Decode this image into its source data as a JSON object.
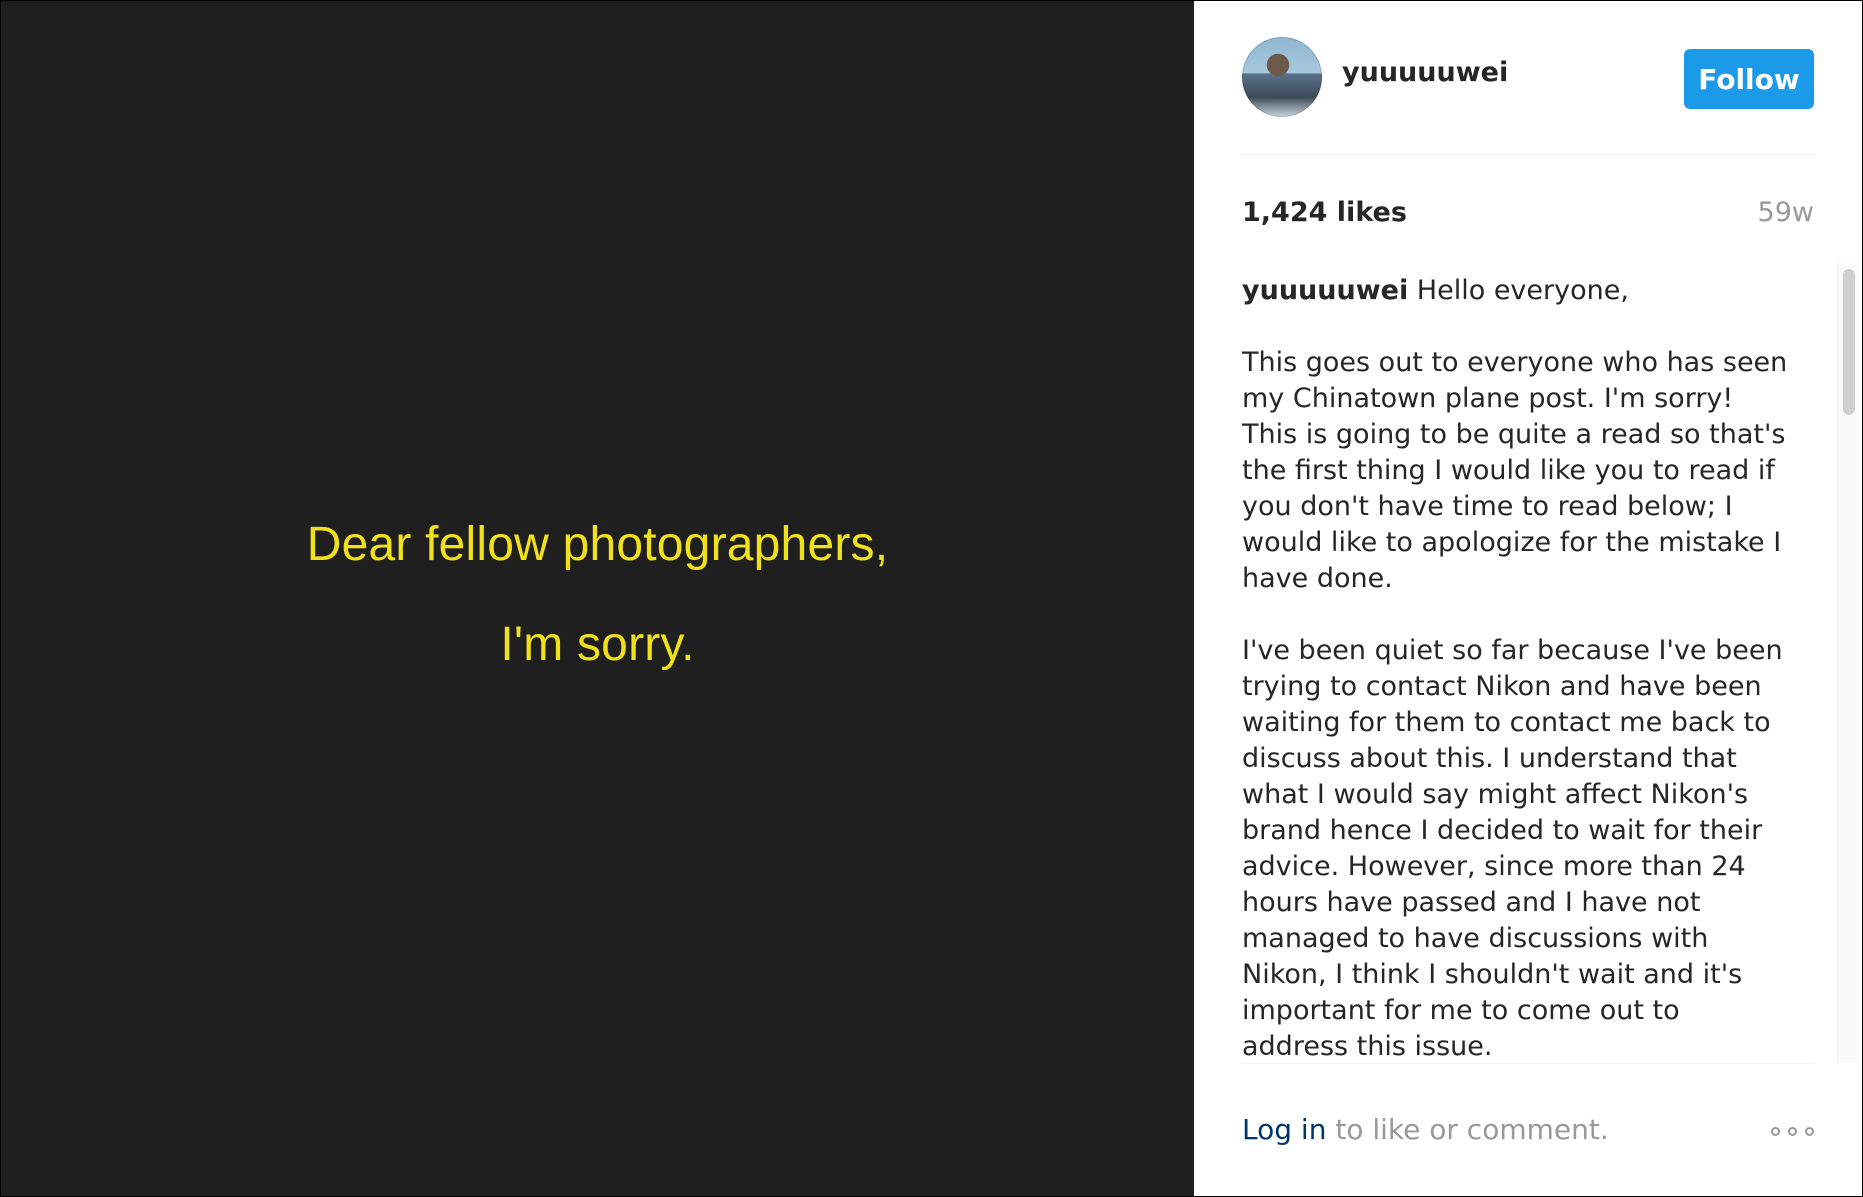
{
  "post": {
    "line1": "Dear fellow photographers,",
    "line2": "I'm sorry."
  },
  "header": {
    "username": "yuuuuuwei",
    "follow_label": "Follow",
    "accent": "#1b9ae9"
  },
  "stats": {
    "likes": "1,424 likes",
    "age": "59w"
  },
  "caption": {
    "author": "yuuuuuwei",
    "greeting": " Hello everyone,",
    "para1": "This goes out to everyone who has seen my Chinatown plane post. I'm sorry! This is going to be quite a read so that's the first thing I would like you to read if you don't have time to read below; I would like to apologize for the mistake I have done.",
    "para2": "I've been quiet so far because I've been trying to contact Nikon and have been waiting for them to contact me back to discuss about this. I understand that what I would say might affect Nikon's brand hence I decided to wait for their advice. However, since more than 24 hours have passed and I have not managed to have discussions with Nikon, I think I shouldn't wait and it's important for me to come out to address this issue."
  },
  "footer": {
    "login_label": "Log in",
    "rest_label": " to like or comment.",
    "more_icon": "more-options-icon"
  }
}
